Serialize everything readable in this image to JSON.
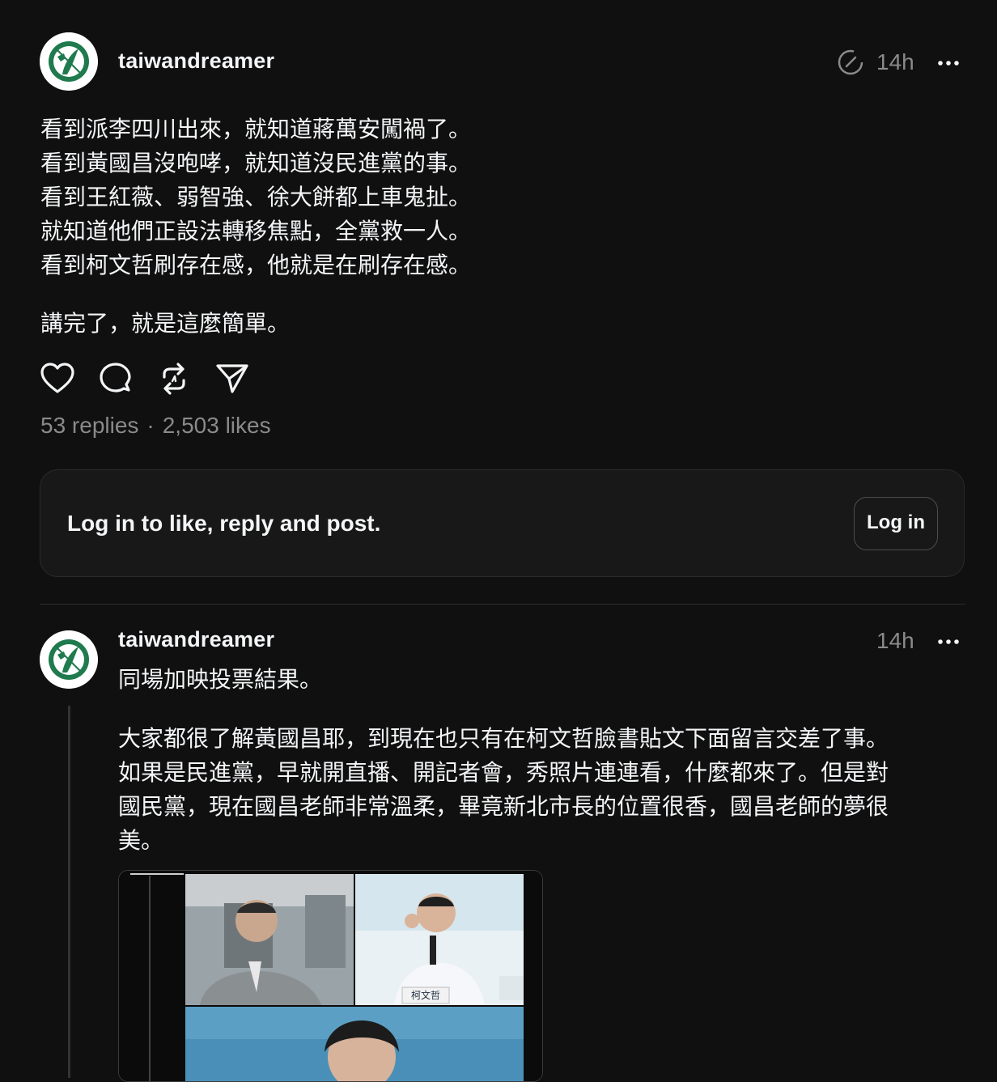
{
  "post": {
    "username": "taiwandreamer",
    "time": "14h",
    "lines": [
      "看到派李四川出來，就知道蔣萬安闖禍了。",
      "看到黃國昌沒咆哮，就知道沒民進黨的事。",
      "看到王紅薇、弱智強、徐大餅都上車鬼扯。",
      "就知道他們正設法轉移焦點，全黨救一人。",
      "看到柯文哲刷存在感，他就是在刷存在感。"
    ],
    "closing": "講完了，就是這麼簡單。",
    "replies": "53 replies",
    "separator": "·",
    "likes": "2,503 likes"
  },
  "login": {
    "prompt": "Log in to like, reply and post.",
    "button": "Log in"
  },
  "reply": {
    "username": "taiwandreamer",
    "time": "14h",
    "first_line": "同場加映投票結果。",
    "body_lines": [
      "大家都很了解黃國昌耶，到現在也只有在柯文哲臉書貼文下面留言交差了事。",
      "如果是民進黨，早就開直播、開記者會，秀照片連連看，什麼都來了。但是對",
      "國民黨，現在國昌老師非常溫柔，畢竟新北市長的位置很香，國昌老師的夢很",
      "美。"
    ],
    "image_caption": "柯文哲"
  },
  "icons": {
    "like": "heart-icon",
    "reply": "comment-icon",
    "repost": "repost-icon",
    "share": "share-icon",
    "more": "more-icon",
    "edited": "edited-icon"
  },
  "colors": {
    "background": "#101010",
    "text": "#f3f5f7",
    "muted": "#8a8a8a",
    "card": "#181818",
    "avatar_green": "#1f7a4d"
  }
}
